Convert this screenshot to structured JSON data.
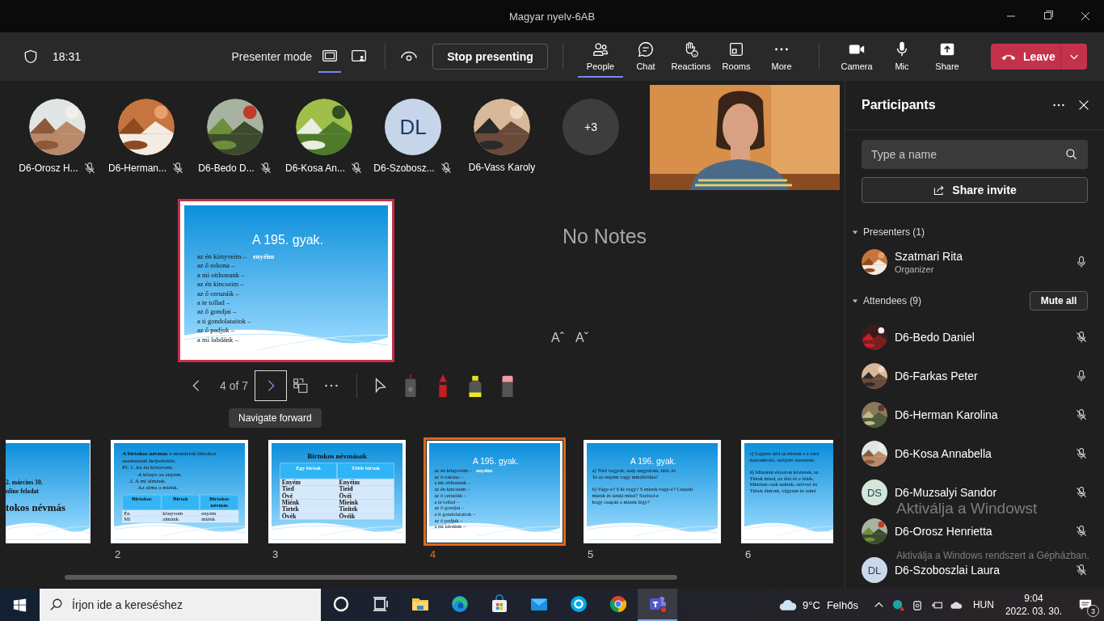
{
  "window": {
    "title": "Magyar nyelv-6AB"
  },
  "toolbar": {
    "time": "18:31",
    "presenter_mode_label": "Presenter mode",
    "presenter_views": [
      {
        "kind": "content",
        "selected": true
      },
      {
        "kind": "standout",
        "selected": false
      }
    ],
    "stop_button": "Stop presenting",
    "actions": [
      {
        "kind": "people",
        "label": "People",
        "selected": true
      },
      {
        "kind": "chat",
        "label": "Chat",
        "selected": false
      },
      {
        "kind": "reactions",
        "label": "Reactions",
        "selected": false
      },
      {
        "kind": "rooms",
        "label": "Rooms",
        "selected": false
      },
      {
        "kind": "more",
        "label": "More",
        "selected": false
      }
    ],
    "devices": [
      {
        "kind": "camera",
        "label": "Camera"
      },
      {
        "kind": "mic",
        "label": "Mic"
      },
      {
        "kind": "share",
        "label": "Share"
      }
    ],
    "leave_button": "Leave"
  },
  "participant_strip": [
    {
      "name": "D6-Orosz H...",
      "muted": true
    },
    {
      "name": "D6-Herman...",
      "muted": true
    },
    {
      "name": "D6-Bedo D...",
      "muted": true
    },
    {
      "name": "D6-Kosa An...",
      "muted": true
    },
    {
      "kind": "initials",
      "initials": "DL",
      "name": "D6-Szobosz...",
      "muted": true
    },
    {
      "name": "D6-Vass Karoly",
      "muted": false
    },
    {
      "kind": "overflow",
      "label": "+3"
    }
  ],
  "self_video": {
    "kind": "picture"
  },
  "current_slide": {
    "kind": "exercise",
    "title": "A 195. gyak.",
    "paragraphs": [
      [
        {
          "text": "az én könyveim –",
          "answer": "enyéim"
        },
        {
          "text": "az ő rokona –"
        },
        {
          "text": "a mi otthonunk –"
        },
        {
          "text": "az én kincseim –"
        },
        {
          "text": "az ő ceruzáik –"
        },
        {
          "text": "a te tollad –"
        },
        {
          "text": "az ő gondjai –"
        },
        {
          "text": "a ti gondolataitok –"
        },
        {
          "text": "az ő padjuk –"
        },
        {
          "text": "a mi labdánk –"
        }
      ]
    ]
  },
  "notes": "No Notes",
  "font_buttons": [
    "Aˆ",
    "Aˇ"
  ],
  "navigation": {
    "counter": "4 of 7",
    "next_focused": true,
    "tooltip": "Navigate forward"
  },
  "thumbnails": [
    {
      "selected": false,
      "slide": {
        "kind": "title",
        "lines": [
          "2. március 30.",
          "nline feladat"
        ],
        "heading": "tokos névmás"
      }
    },
    {
      "number": "2",
      "selected": false,
      "slide": {
        "kind": "notes-table",
        "paragraph": "**A birtokos névmás** a mondatok birtokos szerkezetét helyettesíti.",
        "examples": [
          {
            "text": "Pl: 1. Az én könyvem.",
            "children": [
              {
                "text": "A könyv az enyém."
              }
            ]
          },
          {
            "text": "2. A mi almánk.",
            "children": [
              {
                "text": "Az alma a miénk."
              }
            ]
          }
        ],
        "header": [
          "Birtokos",
          "Birtok",
          "Birtokos névmás"
        ],
        "rows": [
          [
            "Én",
            "könyvem",
            "enyém"
          ],
          [
            "Mi",
            "almánk",
            "miénk"
          ]
        ]
      }
    },
    {
      "number": "3",
      "selected": false,
      "slide": {
        "kind": "table",
        "title": "Birtokos névmások",
        "header": [
          "Egy birtok",
          "Több birtok"
        ],
        "rows": [
          [
            "Enyém",
            "Enyéim"
          ],
          [
            "Tied",
            "Tieid"
          ],
          [
            "Övé",
            "Övéi"
          ],
          [
            "Miénk",
            "Mieink"
          ],
          [
            "Tietek",
            "Tieitek"
          ],
          [
            "Övék",
            "Övéik"
          ]
        ]
      }
    },
    {
      "number": "4",
      "selected": true,
      "slide": {
        "kind": "exercise",
        "title": "A 195. gyak.",
        "paragraphs": [
          [
            {
              "text": "az én könyveim –",
              "answer": "enyéim"
            },
            {
              "text": "az ő rokona –"
            },
            {
              "text": "a mi otthonunk –"
            },
            {
              "text": "az én kincseim –"
            },
            {
              "text": "az ő ceruzáik –"
            },
            {
              "text": "a te tollad –"
            },
            {
              "text": "az ő gondjai –"
            },
            {
              "text": "a ti gondolataitok –"
            },
            {
              "text": "az ő padjuk –"
            },
            {
              "text": "a mi labdánk –"
            }
          ]
        ]
      }
    },
    {
      "number": "5",
      "selected": false,
      "slide": {
        "kind": "exercise",
        "title": "A 196. gyak.",
        "paragraphs": [
          [
            {
              "text": "a) Tiéd vagyok, szép angyalom, tiéd, és"
            },
            {
              "text": "Te az enyém vagy mindörökre!"
            }
          ],
          [
            {
              "text": "b) Vagy-e? S ki vagy? S mienk vagy-e? Csupán"
            },
            {
              "text": "mienk és senki másé? Szabad-e"
            },
            {
              "text": "hogy csupán a mienk légy?"
            }
          ]
        ]
      }
    },
    {
      "number": "6",
      "selected": false,
      "slide": {
        "kind": "exercise",
        "paragraphs": [
          [
            {
              "text": "c) Legyen tiéd az életem s a vére"
            },
            {
              "text": "észromboló, szívjető szerelem."
            }
          ],
          [
            {
              "text": "d) Mindent elosztok köztetek, sz"
            },
            {
              "text": "Tiétek mind, ez élet és e lélek."
            },
            {
              "text": "Mindent csak nektek, szívvel és"
            },
            {
              "text": "Tiétek álmom, vágyam és remé"
            }
          ]
        ]
      }
    }
  ],
  "participants_panel": {
    "title": "Participants",
    "search": {
      "placeholder": "Type a name"
    },
    "share_button": "Share invite",
    "sections": [
      {
        "label": "Presenters (1)",
        "expanded": true,
        "people": [
          {
            "name": "Szatmari Rita",
            "role": "Organizer",
            "muted": false
          }
        ]
      },
      {
        "label": "Attendees (9)",
        "expanded": true,
        "action": "Mute all",
        "people": [
          {
            "name": "D6-Bedo Daniel",
            "muted": true
          },
          {
            "name": "D6-Farkas Peter",
            "muted": false
          },
          {
            "name": "D6-Herman Karolina",
            "muted": true
          },
          {
            "name": "D6-Kosa Annabella",
            "muted": true
          },
          {
            "name": "D6-Muzsalyi Sandor",
            "kind": "initials",
            "initials": "DS",
            "color": "#d4e6d8",
            "muted": true
          },
          {
            "name": "D6-Orosz Henrietta",
            "muted": true
          },
          {
            "name": "D6-Szoboszlai Laura",
            "kind": "initials",
            "initials": "DL",
            "color": "#cbd8ec",
            "muted": true
          }
        ]
      }
    ]
  },
  "windows_notice": {
    "title": "Aktiválja a Windowst",
    "text": "Aktiválja a Windows rendszert a Gépházban."
  },
  "taskbar": {
    "search": {
      "placeholder": "Írjon ide a kereséshez"
    },
    "apps": [
      {
        "kind": "cortana",
        "active": false
      },
      {
        "kind": "task-view",
        "active": false
      },
      {
        "kind": "files",
        "active": false
      },
      {
        "kind": "edge",
        "active": false
      },
      {
        "kind": "store",
        "active": false
      },
      {
        "kind": "mail",
        "active": false
      },
      {
        "kind": "skype",
        "active": false
      },
      {
        "kind": "chrome",
        "active": false
      },
      {
        "kind": "teams",
        "active": true
      }
    ],
    "temperature": "9°C",
    "weather": "Felhős",
    "language": "HUN",
    "time": "9:04",
    "date": "2022. 03. 30.",
    "notifications": "3"
  }
}
